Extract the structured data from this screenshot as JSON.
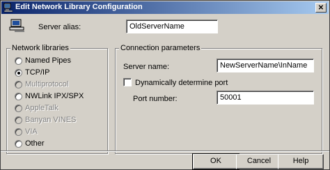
{
  "window": {
    "title": "Edit Network Library Configuration",
    "close_glyph": "✕"
  },
  "server_alias": {
    "label": "Server alias:",
    "value": "OldServerName"
  },
  "network_libraries": {
    "group_label": "Network libraries",
    "items": [
      {
        "label": "Named Pipes",
        "enabled": true,
        "selected": false
      },
      {
        "label": "TCP/IP",
        "enabled": true,
        "selected": true
      },
      {
        "label": "Multiprotocol",
        "enabled": false,
        "selected": false
      },
      {
        "label": "NWLink IPX/SPX",
        "enabled": true,
        "selected": false
      },
      {
        "label": "AppleTalk",
        "enabled": false,
        "selected": false
      },
      {
        "label": "Banyan VINES",
        "enabled": false,
        "selected": false
      },
      {
        "label": "VIA",
        "enabled": false,
        "selected": false
      },
      {
        "label": "Other",
        "enabled": true,
        "selected": false
      }
    ]
  },
  "connection_parameters": {
    "group_label": "Connection parameters",
    "server_name_label": "Server name:",
    "server_name_value": "NewServerName\\InName",
    "dynamic_port_label": "Dynamically determine port",
    "dynamic_port_checked": false,
    "port_label": "Port number:",
    "port_value": "50001"
  },
  "buttons": {
    "ok": "OK",
    "cancel": "Cancel",
    "help": "Help"
  }
}
